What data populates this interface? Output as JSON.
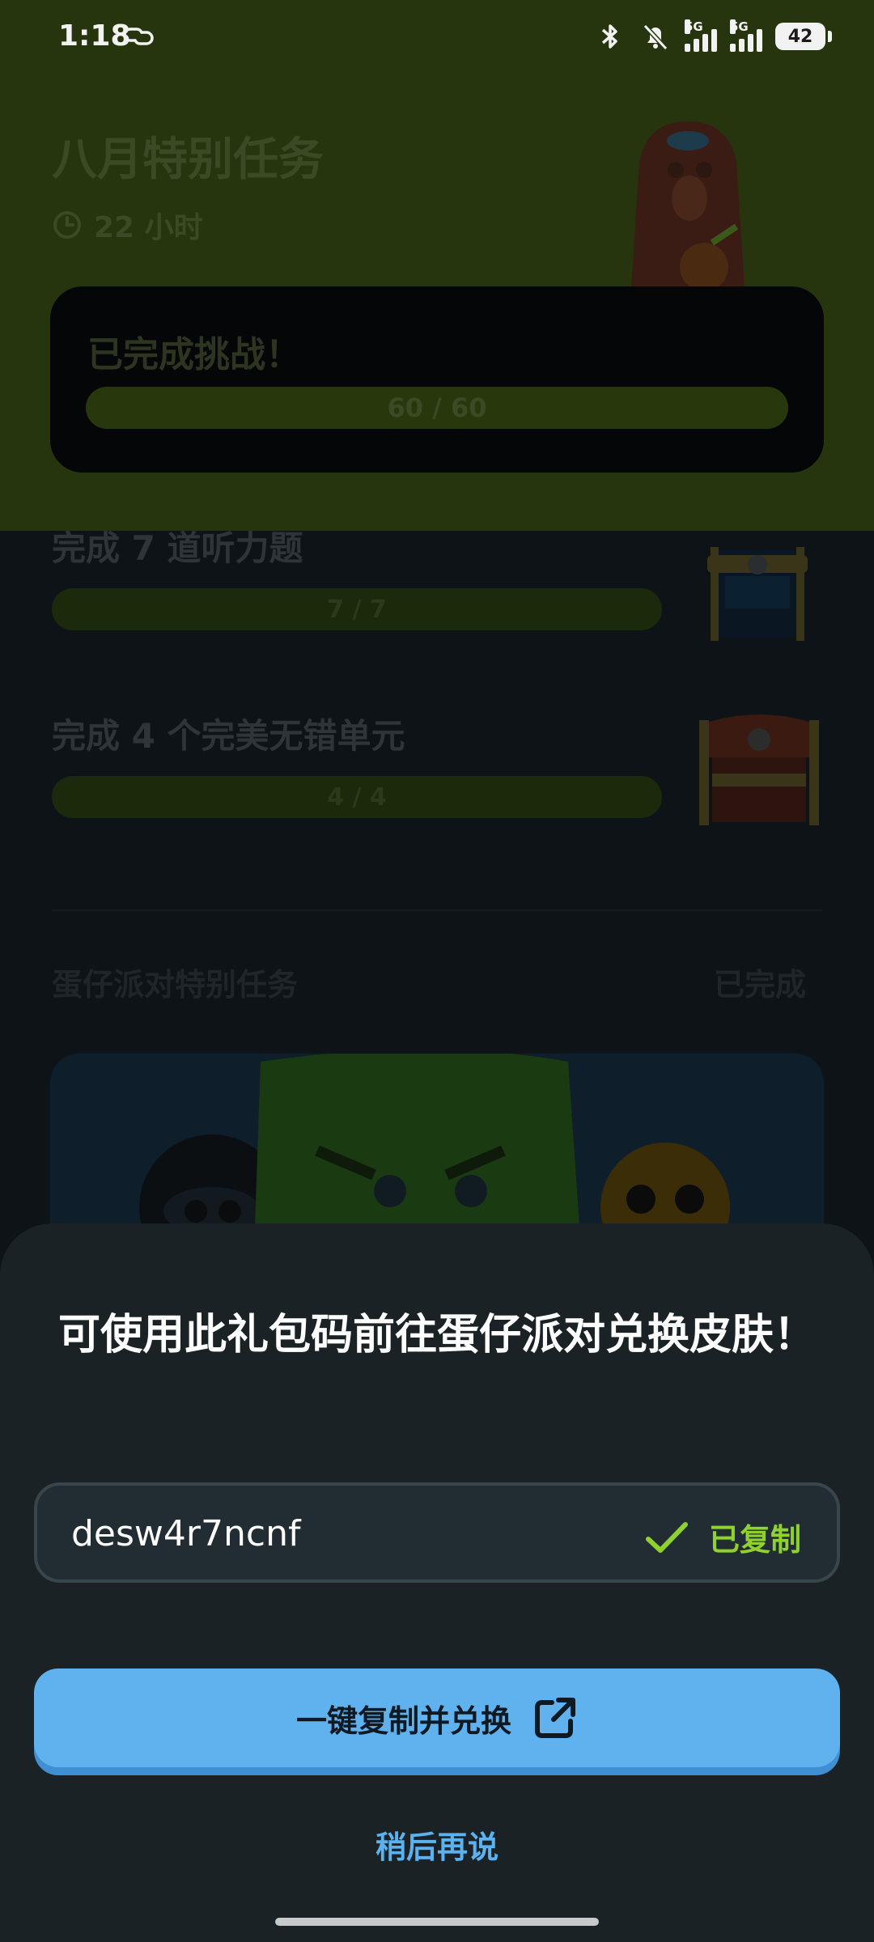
{
  "status_bar": {
    "time": "1:18",
    "network_1": "5G",
    "network_2": "5G",
    "battery": "42"
  },
  "quest": {
    "title": "八月特别任务",
    "timer": "22 小时",
    "challenge_label": "已完成挑战！",
    "challenge_progress": "60 / 60"
  },
  "tasks": [
    {
      "label": "完成 7 道听力题",
      "progress": "7 / 7"
    },
    {
      "label": "完成 4 个完美无错单元",
      "progress": "4 / 4"
    }
  ],
  "section": {
    "title": "蛋仔派对特别任务",
    "status": "已完成"
  },
  "sheet": {
    "title": "可使用此礼包码前往蛋仔派对兑换皮肤！",
    "code": "desw4r7ncnf",
    "copied_label": "已复制",
    "primary_button": "一键复制并兑换",
    "later_link": "稍后再说"
  },
  "colors": {
    "accent_green": "#8fd12d",
    "button_blue": "#60b2ee",
    "link_blue": "#5ab3f0",
    "sheet_bg": "#1a2226"
  },
  "icons": [
    "link-icon",
    "bluetooth-icon",
    "bell-muted-icon",
    "clock-icon",
    "check-icon",
    "external-link-icon",
    "treasure-chest-icon"
  ]
}
